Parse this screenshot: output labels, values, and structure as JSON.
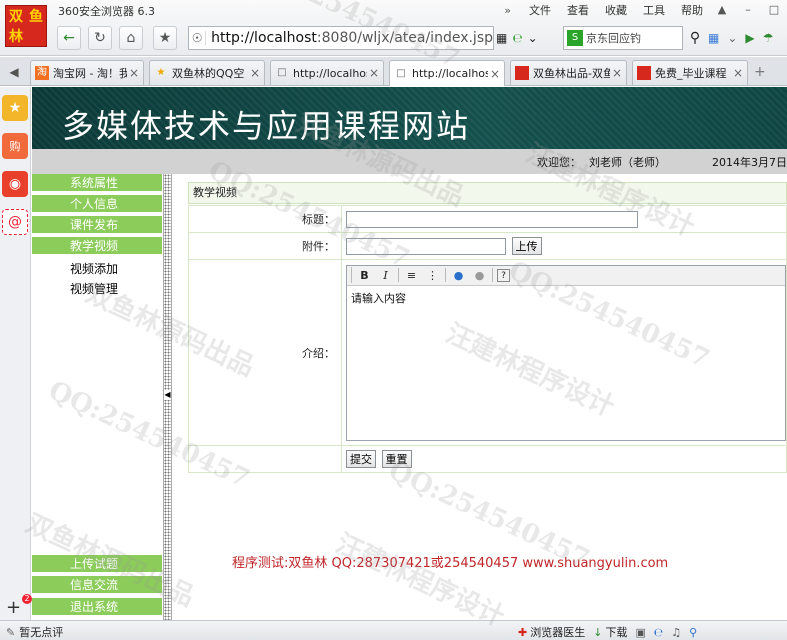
{
  "browser": {
    "logo": [
      "双",
      "鱼",
      "林"
    ],
    "title": "360安全浏览器 6.3",
    "menu": [
      "文件",
      "查看",
      "收藏",
      "工具",
      "帮助"
    ],
    "menu_more": "»",
    "address": {
      "host": "http://localhost",
      "rest": ":8080/wljx/atea/index.jsp"
    },
    "search": "京东回应钓",
    "tabs": [
      {
        "label": "淘宝网 - 淘！我",
        "icon": "taobao-icon"
      },
      {
        "label": "双鱼林的QQ空",
        "icon": "star-icon"
      },
      {
        "label": "http://localhos",
        "icon": "page-icon"
      },
      {
        "label": "http://localhos",
        "icon": "page-icon",
        "active": true
      },
      {
        "label": "双鱼林出品-双鱼",
        "icon": "site-icon"
      },
      {
        "label": "免费_毕业课程",
        "icon": "site-icon"
      }
    ],
    "sidebar_badge": "2"
  },
  "site": {
    "title": "多媒体技术与应用课程网站",
    "welcome_label": "欢迎您：",
    "welcome_user": "刘老师（老师）",
    "date": "2014年3月7日"
  },
  "nav": {
    "items": [
      "系统属性",
      "个人信息",
      "课件发布",
      "教学视频"
    ],
    "subitems": [
      "视频添加",
      "视频管理"
    ],
    "bottom_items": [
      "上传试题",
      "信息交流",
      "退出系统"
    ]
  },
  "form": {
    "breadcrumb": "教学视频",
    "title_label": "标题：",
    "attachment_label": "附件：",
    "upload_button": "上传",
    "intro_label": "介绍：",
    "editor_placeholder": "请输入内容",
    "submit_button": "提交",
    "reset_button": "重置"
  },
  "footer_note": "程序测试:双鱼林 QQ:287307421或254540457 www.shuangyulin.com",
  "watermarks": [
    "QQ:254540457",
    "双鱼林源码出品",
    "汪建林程序设计"
  ],
  "status": {
    "left": "暂无点评",
    "doctor": "浏览器医生",
    "download": "下载"
  },
  "colors": {
    "header_bg": "#14504d",
    "nav_green": "#8ccc5a",
    "footer_red": "#c0262a"
  }
}
